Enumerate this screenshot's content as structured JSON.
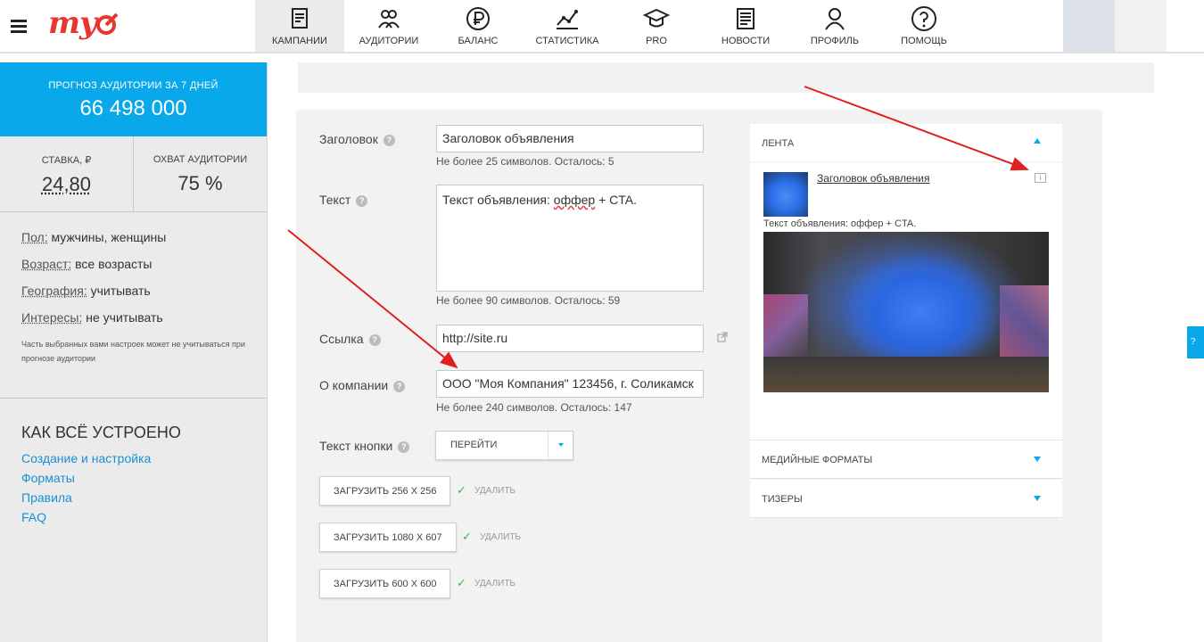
{
  "header": {
    "logo": "my",
    "nav": [
      {
        "label": "КАМПАНИИ",
        "icon": "campaigns-icon",
        "active": true
      },
      {
        "label": "АУДИТОРИИ",
        "icon": "audiences-icon"
      },
      {
        "label": "БАЛАНС",
        "icon": "ruble-icon"
      },
      {
        "label": "СТАТИСТИКА",
        "icon": "statistics-icon"
      },
      {
        "label": "PRO",
        "icon": "graduation-cap-icon"
      },
      {
        "label": "НОВОСТИ",
        "icon": "news-icon"
      },
      {
        "label": "ПРОФИЛЬ",
        "icon": "profile-icon"
      },
      {
        "label": "ПОМОЩЬ",
        "icon": "help-icon"
      }
    ]
  },
  "sidebar": {
    "forecast_label": "ПРОГНОЗ АУДИТОРИИ ЗА 7 ДНЕЙ",
    "forecast_value": "66 498 000",
    "bid_label": "СТАВКА, ₽",
    "bid_value": "24,80",
    "reach_label": "ОХВАТ АУДИТОРИИ",
    "reach_value": "75 %",
    "targeting": [
      {
        "key": "Пол:",
        "value": "мужчины, женщины"
      },
      {
        "key": "Возраст:",
        "value": "все возрасты"
      },
      {
        "key": "География:",
        "value": "учитывать"
      },
      {
        "key": "Интересы:",
        "value": "не учитывать"
      }
    ],
    "note": "Часть выбранных вами настроек может не учитываться при прогнозе аудитории",
    "howto_title": "КАК ВСЁ УСТРОЕНО",
    "links": [
      "Создание и настройка",
      "Форматы",
      "Правила",
      "FAQ"
    ]
  },
  "form": {
    "title_label": "Заголовок",
    "title_value": "Заголовок объявления",
    "title_hint": "Не более  25  символов. Осталось: 5",
    "text_label": "Текст",
    "text_value_before": "Текст объявления: ",
    "text_value_spell": "оффер",
    "text_value_after": " + CTA.",
    "text_hint": "Не более  90  символов. Осталось: 59",
    "link_label": "Ссылка",
    "link_value": "http://site.ru",
    "company_label": "О компании",
    "company_value": "ООО \"Моя Компания\"  123456, г. Соликамск",
    "company_hint": "Не более  240  символов. Осталось: 147",
    "button_label": "Текст кнопки",
    "button_value": "ПЕРЕЙТИ",
    "upload1": "ЗАГРУЗИТЬ 256 X 256",
    "upload2": "ЗАГРУЗИТЬ 1080 X 607",
    "upload3": "ЗАГРУЗИТЬ 600 X 600",
    "delete_label": "УДАЛИТЬ",
    "check_glyph": "✓"
  },
  "preview": {
    "feed_label": "ЛЕНТА",
    "ad_title": "Заголовок объявления",
    "ad_text": "Текст объявления: оффер + CTA.",
    "info_glyph": "i",
    "media_label": "МЕДИЙНЫЕ ФОРМАТЫ",
    "teasers_label": "ТИЗЕРЫ"
  },
  "right_tab": "?",
  "colors": {
    "accent": "#08a8ea",
    "brand": "#e8352f",
    "arrow": "#e02020",
    "link": "#1a8fd6"
  }
}
